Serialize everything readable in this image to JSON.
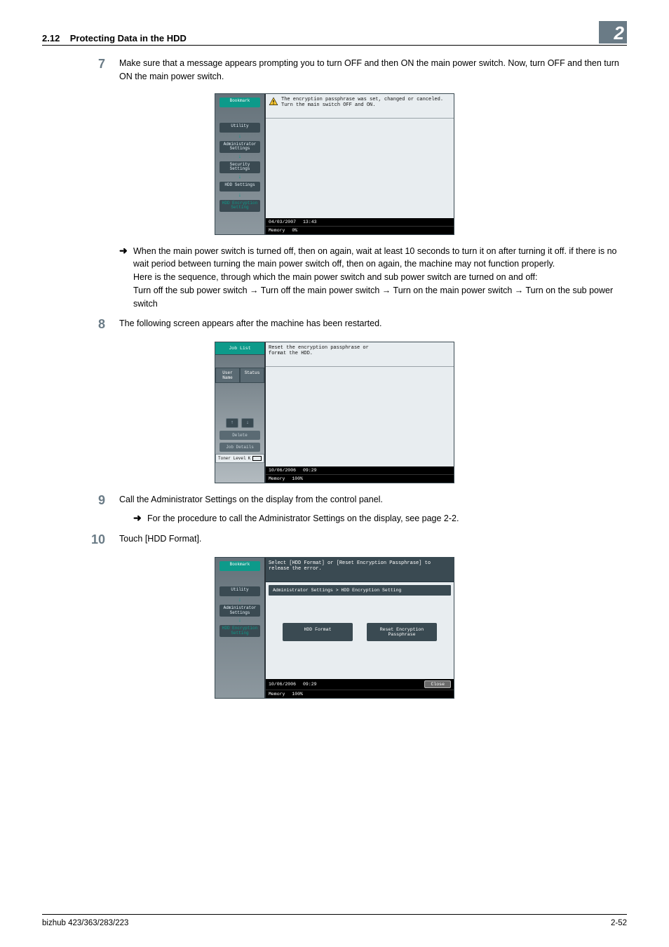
{
  "header": {
    "section_number": "2.12",
    "section_title": "Protecting Data in the HDD",
    "chapter_badge": "2"
  },
  "steps": {
    "s7": {
      "num": "7",
      "text": "Make sure that a message appears prompting you to turn OFF and then ON the main power switch. Now, turn OFF and then turn ON the main power switch."
    },
    "s7_bullet": {
      "p1": "When the main power switch is turned off, then on again, wait at least 10 seconds to turn it on after turning it off. if there is no wait period between turning the main power switch off, then on again, the machine may not function properly.",
      "p2": "Here is the sequence, through which the main power switch and sub power switch are turned on and off:",
      "p3": "Turn off the sub power switch → Turn off the main power switch → Turn on the main power switch → Turn on the sub power switch"
    },
    "s8": {
      "num": "8",
      "text": "The following screen appears after the machine has been restarted."
    },
    "s9": {
      "num": "9",
      "text": "Call the Administrator Settings on the display from the control panel.",
      "bullet": "For the procedure to call the Administrator Settings on the display, see page 2-2."
    },
    "s10": {
      "num": "10",
      "text": "Touch [HDD Format]."
    }
  },
  "screen1": {
    "msg_l1": "The encryption passphrase was set, changed or canceled.",
    "msg_l2": "Turn the main switch OFF and ON.",
    "side": {
      "bookmark": "Bookmark",
      "utility": "Utility",
      "admin": "Administrator\nSettings",
      "security": "Security\nSettings",
      "hdd": "HDD Settings",
      "enc": "HDD Encryption\nSetting"
    },
    "status": {
      "date": "04/03/2007",
      "time": "13:43",
      "mem_label": "Memory",
      "mem_val": "0%"
    }
  },
  "screen2": {
    "msg_l1": "Reset the encryption passphrase or",
    "msg_l2": "format the HDD.",
    "side": {
      "joblist": "Job List",
      "user_name": "User\nName",
      "status": "Status",
      "delete": "Delete",
      "jobdetails": "Job Details",
      "toner": "Toner Level",
      "toner_k": "K"
    },
    "status": {
      "date": "10/06/2006",
      "time": "09:29",
      "mem_label": "Memory",
      "mem_val": "100%"
    }
  },
  "screen3": {
    "msg": "Select [HDD Format] or [Reset Encryption Passphrase] to release the error.",
    "crumb": "Administrator Settings > HDD Encryption Setting",
    "side": {
      "bookmark": "Bookmark",
      "utility": "Utility",
      "admin": "Administrator\nSettings",
      "enc": "HDD Encryption\nSetting"
    },
    "btn_format": "HDD Format",
    "btn_reset": "Reset Encryption Passphrase",
    "status": {
      "date": "10/06/2006",
      "time": "09:29",
      "mem_label": "Memory",
      "mem_val": "100%",
      "close": "Close"
    }
  },
  "footer": {
    "left": "bizhub 423/363/283/223",
    "right": "2-52"
  },
  "glyphs": {
    "arrow": "➜",
    "rarr": "→",
    "darr": "↓",
    "uarr": "↑"
  }
}
